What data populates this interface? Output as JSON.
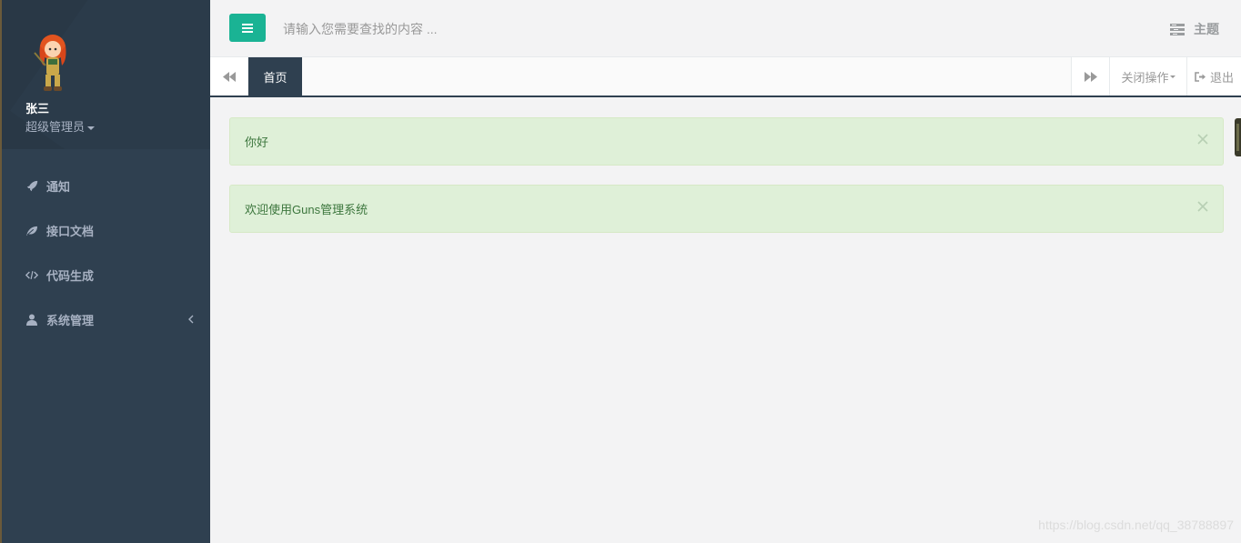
{
  "sidebar": {
    "user": {
      "name": "张三",
      "role": "超级管理员"
    },
    "items": [
      {
        "label": "通知",
        "icon": "rocket-icon"
      },
      {
        "label": "接口文档",
        "icon": "leaf-icon"
      },
      {
        "label": "代码生成",
        "icon": "code-icon"
      },
      {
        "label": "系统管理",
        "icon": "user-icon"
      }
    ]
  },
  "topbar": {
    "search_placeholder": "请输入您需要查找的内容 ...",
    "theme_label": "主题"
  },
  "tabs": {
    "home_label": "首页",
    "close_ops_label": "关闭操作",
    "logout_label": "退出"
  },
  "alerts": [
    {
      "text": "你好"
    },
    {
      "text": "欢迎使用Guns管理系统"
    }
  ],
  "watermark": "https://blog.csdn.net/qq_38788897",
  "colors": {
    "sidebar": "#2f4050",
    "accent": "#1ab394",
    "alert_bg": "#dff0d8",
    "alert_text": "#3c763d"
  }
}
